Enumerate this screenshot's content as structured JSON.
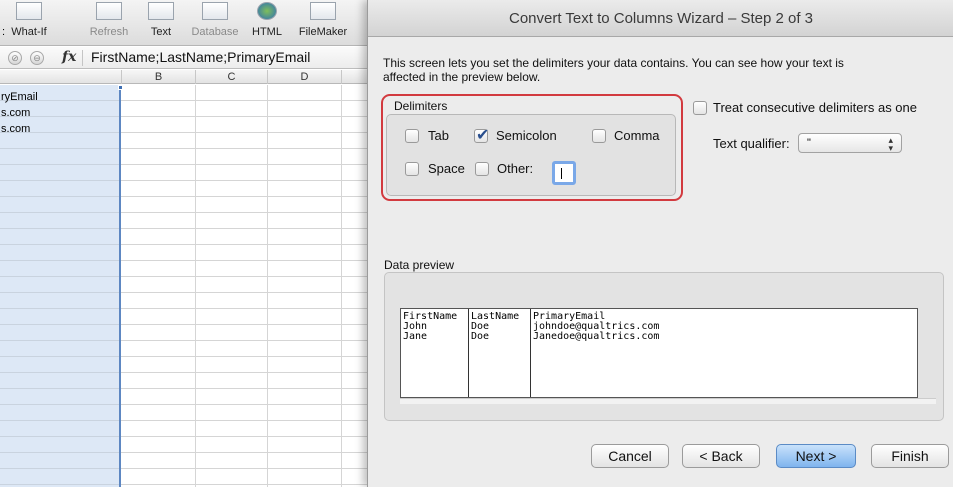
{
  "excel": {
    "ribbon": [
      "What-If",
      "Refresh",
      "Text",
      "Database",
      "HTML",
      "FileMaker"
    ],
    "ribbon_prefix": ":",
    "fx_label": "fx",
    "formula": "FirstName;LastName;PrimaryEmail",
    "columns": [
      "B",
      "C",
      "D"
    ],
    "cells": [
      "ryEmail",
      "s.com",
      "s.com"
    ]
  },
  "dialog": {
    "title": "Convert Text to Columns Wizard – Step 2 of 3",
    "intro_line1": "This screen lets you set the delimiters your data contains.  You can see how your text is",
    "intro_line2": "affected in the preview below.",
    "delimiters_label": "Delimiters",
    "options": {
      "tab": {
        "label": "Tab",
        "checked": false
      },
      "semicolon": {
        "label": "Semicolon",
        "checked": true
      },
      "comma": {
        "label": "Comma",
        "checked": false
      },
      "space": {
        "label": "Space",
        "checked": false
      },
      "other": {
        "label": "Other:",
        "checked": false,
        "value": ""
      }
    },
    "consecutive": {
      "label": "Treat consecutive delimiters as one",
      "checked": false
    },
    "qualifier": {
      "label": "Text qualifier:",
      "value": "\""
    },
    "preview_label": "Data preview",
    "preview": {
      "columns": [
        [
          "FirstName",
          "John",
          "Jane"
        ],
        [
          "LastName",
          "Doe",
          "Doe"
        ],
        [
          "PrimaryEmail",
          "johndoe@qualtrics.com",
          "Janedoe@qualtrics.com"
        ]
      ]
    },
    "buttons": {
      "cancel": "Cancel",
      "back": "< Back",
      "next": "Next >",
      "finish": "Finish"
    }
  },
  "colors": {
    "highlight": "#d23a3f",
    "primary_button": "#7fb4ee",
    "selection": "#dde8f6"
  }
}
